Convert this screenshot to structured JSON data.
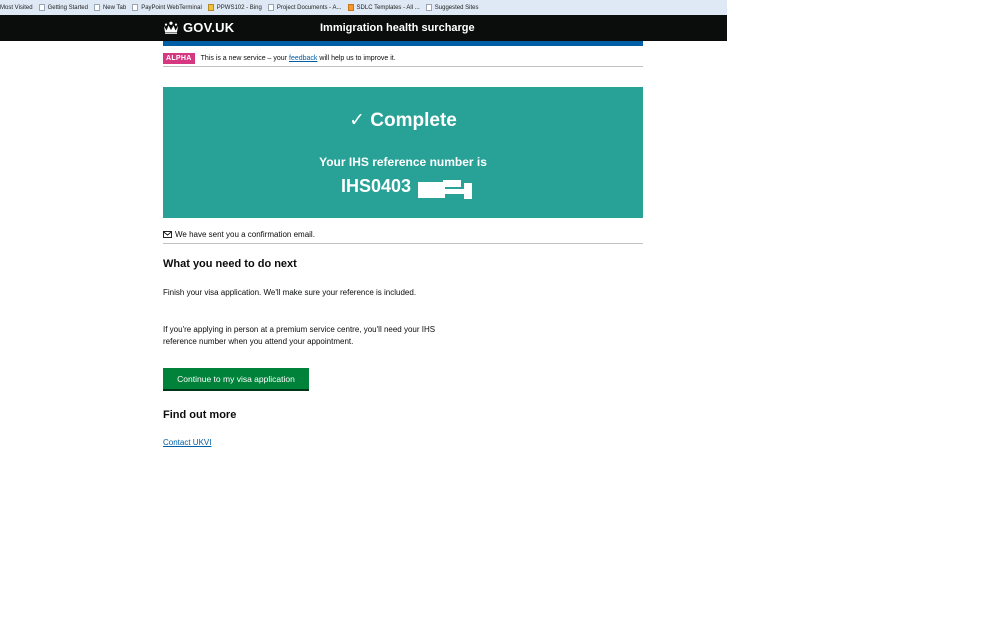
{
  "bookmarks": [
    {
      "label": "Most Visited",
      "icon": "page-icon"
    },
    {
      "label": "Getting Started",
      "icon": "page-icon"
    },
    {
      "label": "New Tab",
      "icon": "page-icon"
    },
    {
      "label": "PayPoint WebTerminal",
      "icon": "page-icon"
    },
    {
      "label": "PPWS102 - Bing",
      "icon": "bing-icon"
    },
    {
      "label": "Project Documents - A...",
      "icon": "page-icon"
    },
    {
      "label": "SDLC Templates - All ...",
      "icon": "rss-icon"
    },
    {
      "label": "Suggested Sites",
      "icon": "page-icon"
    }
  ],
  "header": {
    "logo_text": "GOV.UK",
    "service_name": "Immigration health surcharge"
  },
  "phase_banner": {
    "tag": "ALPHA",
    "text_before": "This is a new service – your",
    "link": "feedback",
    "text_after": "will help us to improve it."
  },
  "confirmation": {
    "title": "✓ Complete",
    "subtitle": "Your IHS reference number is",
    "reference": "IHS0403"
  },
  "email_notice": "We have sent you a confirmation email.",
  "next_steps": {
    "heading": "What you need to do next",
    "paragraph1": "Finish your visa application. We'll make sure your reference is included.",
    "paragraph2": "If you're applying in person at a premium service centre, you'll need your IHS reference number when you attend your appointment.",
    "button": "Continue to my visa application"
  },
  "find_out_more": {
    "heading": "Find out more",
    "link": "Contact UKVI"
  },
  "colors": {
    "header_bg": "#0b0c0c",
    "panel_bg": "#28a197",
    "button_bg": "#00823b",
    "link": "#005ea5",
    "alpha_tag": "#d53880",
    "header_accent": "#005ea5"
  }
}
